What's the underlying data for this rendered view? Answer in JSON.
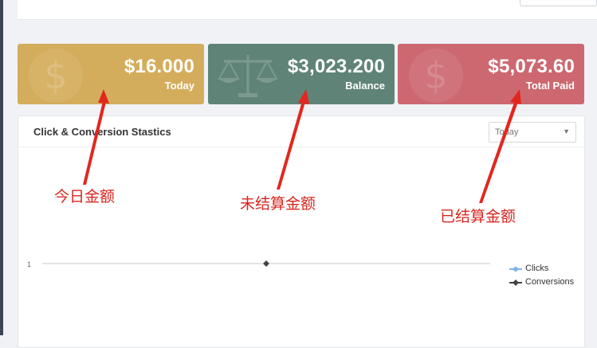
{
  "cards": [
    {
      "value": "$16.000",
      "label": "Today",
      "color": "#d4ad5c",
      "icon": "dollar-icon"
    },
    {
      "value": "$3,023.200",
      "label": "Balance",
      "color": "#5f8477",
      "icon": "scale-icon"
    },
    {
      "value": "$5,073.60",
      "label": "Total Paid",
      "color": "#cd6870",
      "icon": "dollar-icon"
    }
  ],
  "chart": {
    "title": "Click & Conversion Stastics",
    "period_select": {
      "selected": "Today"
    },
    "y_tick": "1",
    "legend": [
      {
        "name": "Clicks",
        "color": "#7cb5ec"
      },
      {
        "name": "Conversions",
        "color": "#434348"
      }
    ]
  },
  "annotations": {
    "today": "今日金额",
    "balance": "未结算金额",
    "paid": "已结算金额",
    "color": "#d8261f"
  }
}
